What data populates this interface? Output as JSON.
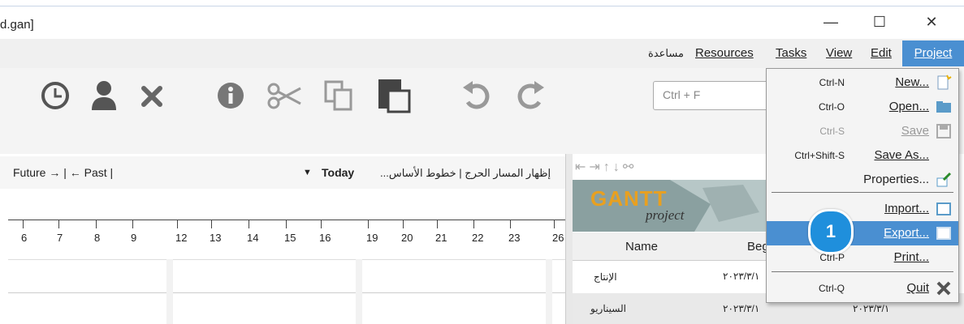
{
  "window": {
    "title": "d.gan]",
    "minimize_glyph": "—",
    "maximize_glyph": "☐",
    "close_glyph": "✕"
  },
  "menubar": {
    "items": [
      {
        "label": "مساعدة",
        "underlined": false
      },
      {
        "label": "Resources",
        "underlined": true
      },
      {
        "label": "Tasks",
        "underlined": true
      },
      {
        "label": "View",
        "underlined": true
      },
      {
        "label": "Edit",
        "underlined": true
      },
      {
        "label": "Project",
        "underlined": true,
        "active": true
      }
    ]
  },
  "toolbar": {
    "icons": [
      "clock-icon",
      "user-icon",
      "delete-icon",
      "info-icon",
      "cut-icon",
      "copy-icon",
      "paste-icon",
      "undo-icon",
      "redo-icon"
    ],
    "search_placeholder": "Ctrl + F"
  },
  "navigation": {
    "left_text": "Future → | ← Past |",
    "today_label": "Today",
    "right_text": "إظهار المسار الحرج | خطوط الأساس..."
  },
  "timeline": {
    "days": [
      "6",
      "7",
      "8",
      "9",
      "12",
      "13",
      "14",
      "15",
      "16",
      "19",
      "20",
      "21",
      "22",
      "23",
      "26"
    ]
  },
  "task_grid": {
    "logo_text": "GANTT",
    "logo_sub": "project",
    "columns": [
      "Name",
      "Beg"
    ],
    "rows": [
      {
        "name": "الإنتاج",
        "begin": "٢٠٢٣/٣/١"
      },
      {
        "name": "السيناريو",
        "begin": "٢٠٢٣/٣/١",
        "end": "٢٠٢٣/٣/١"
      }
    ]
  },
  "project_menu": {
    "items": [
      {
        "shortcut": "Ctrl-N",
        "label": "New...",
        "icon": "new-file-icon"
      },
      {
        "shortcut": "Ctrl-O",
        "label": "Open...",
        "icon": "open-folder-icon"
      },
      {
        "shortcut": "Ctrl-S",
        "label": "Save",
        "icon": "save-icon",
        "disabled": true
      },
      {
        "shortcut": "Ctrl+Shift-S",
        "label": "Save As...",
        "icon": ""
      },
      {
        "shortcut": "",
        "label": "Properties...",
        "icon": "properties-icon"
      },
      {
        "shortcut": "",
        "label": "Import...",
        "icon": "import-icon"
      },
      {
        "shortcut": "",
        "label": "Export...",
        "icon": "export-icon",
        "highlighted": true
      },
      {
        "shortcut": "Ctrl-P",
        "label": "Print...",
        "icon": ""
      },
      {
        "shortcut": "Ctrl-Q",
        "label": "Quit",
        "icon": "quit-icon"
      }
    ]
  },
  "callout": {
    "number": "1"
  },
  "colors": {
    "accent": "#4a8fd1",
    "callout": "#1f8fdc"
  }
}
